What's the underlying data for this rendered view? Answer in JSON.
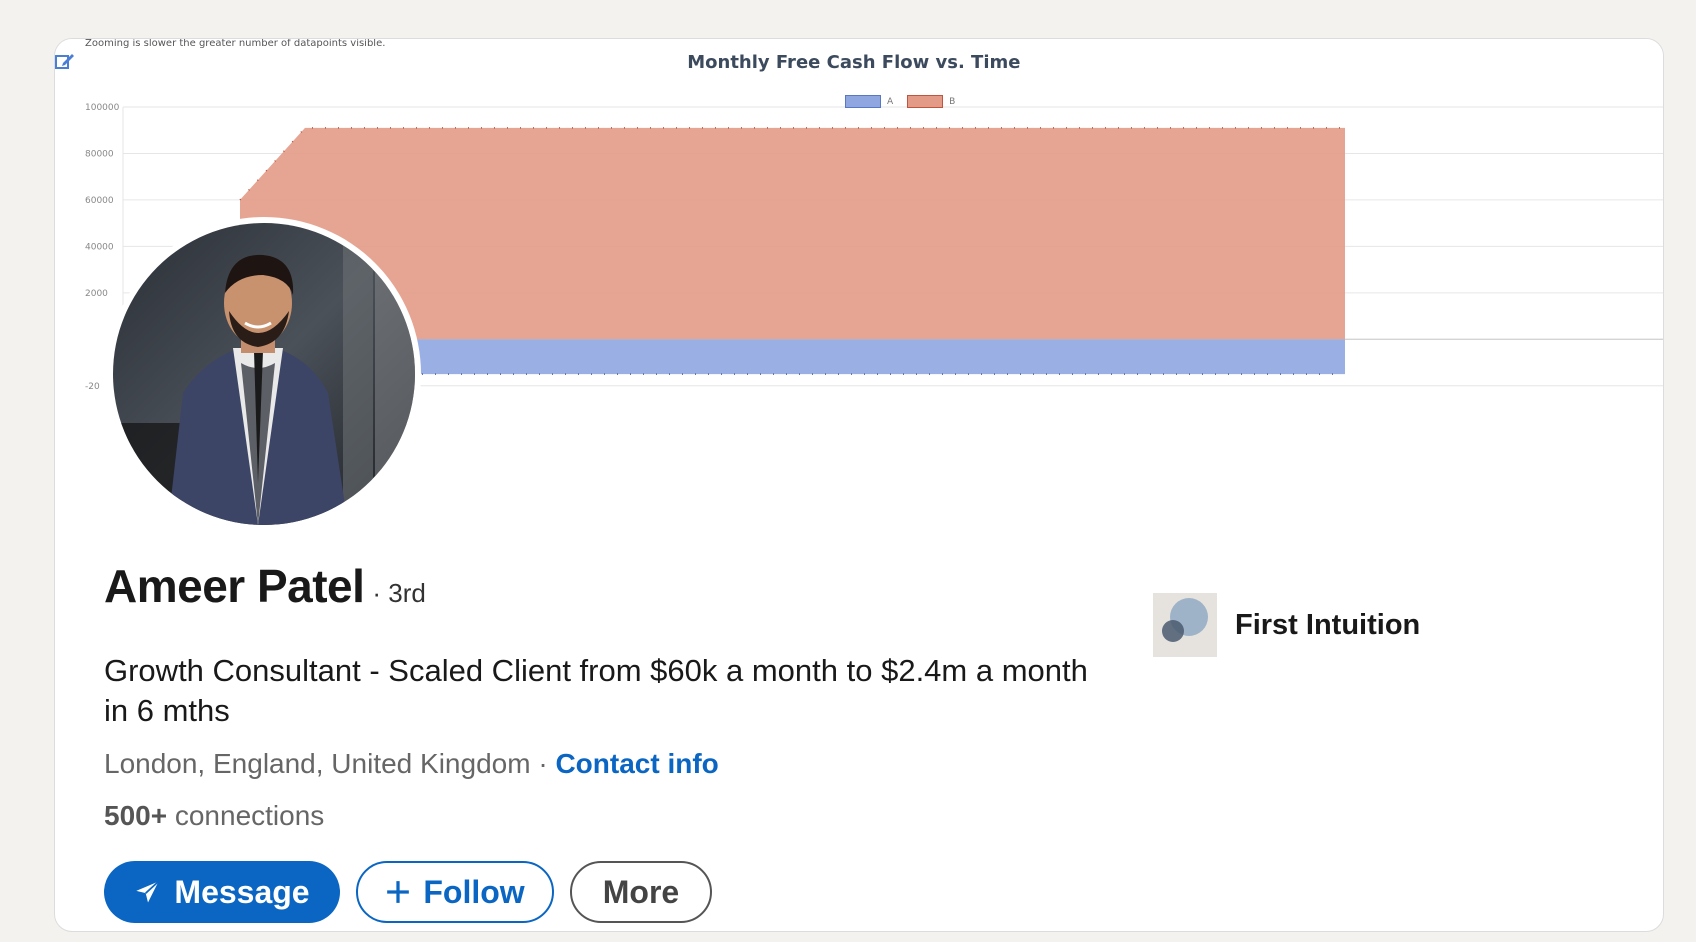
{
  "profile": {
    "name": "Ameer Patel",
    "degree": "· 3rd",
    "headline": "Growth Consultant - Scaled Client from $60k a month to $2.4m a month in 6 mths",
    "location": "London, England, United Kingdom",
    "separator": " · ",
    "contact_info": "Contact info",
    "connections_count": "500+",
    "connections_label": " connections"
  },
  "actions": {
    "message": "Message",
    "follow": "Follow",
    "more": "More"
  },
  "company": {
    "name": "First Intuition"
  },
  "cover": {
    "zoom_note": "Zooming is slower the greater number of datapoints visible."
  },
  "chart_data": {
    "type": "area",
    "title": "Monthly Free Cash Flow vs. Time",
    "legend": [
      "A",
      "B"
    ],
    "legend_position": "top",
    "y_ticks": [
      "100000",
      "80000",
      "60000",
      "40000",
      "2000",
      "-20"
    ],
    "ylim": [
      -30000,
      100000
    ],
    "grid": true,
    "series": [
      {
        "name": "A",
        "color": "#8fa6e0",
        "plateau": -15000
      },
      {
        "name": "B",
        "color": "#e39a87",
        "plateau": 91000
      }
    ]
  },
  "colors": {
    "accent": "#0a66c2",
    "background": "#f3f2ef"
  }
}
